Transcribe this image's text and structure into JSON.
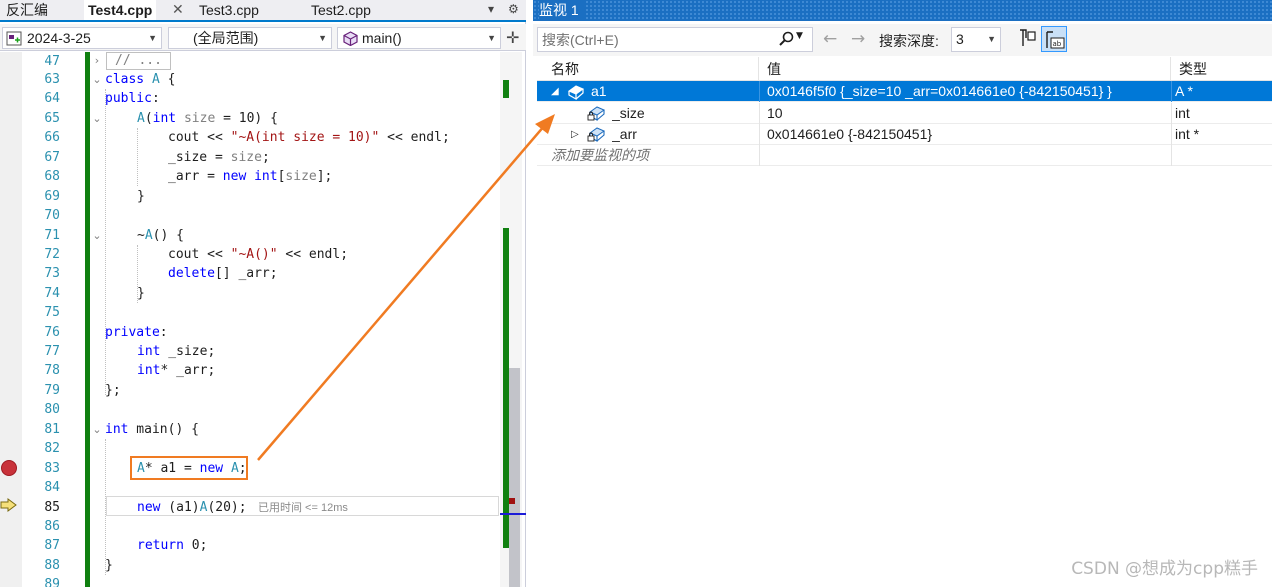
{
  "editor": {
    "tabs": [
      {
        "label": "反汇编",
        "active": false
      },
      {
        "label": "Test4.cpp",
        "active": true
      },
      {
        "label": "Test3.cpp",
        "active": false
      },
      {
        "label": "Test2.cpp",
        "active": false
      }
    ],
    "close_glyph": "✕",
    "navbar": {
      "project": "2024-3-25",
      "scope": "(全局范围)",
      "function": "main()"
    },
    "lines": [
      {
        "n": "47",
        "text": "// ..."
      },
      {
        "n": "63",
        "text": "class A {"
      },
      {
        "n": "64",
        "text": "public:"
      },
      {
        "n": "65",
        "text": "A(int size = 10) {"
      },
      {
        "n": "66",
        "text": "cout << \"~A(int size = 10)\" << endl;"
      },
      {
        "n": "67",
        "text": "_size = size;"
      },
      {
        "n": "68",
        "text": "_arr = new int[size];"
      },
      {
        "n": "69",
        "text": "}"
      },
      {
        "n": "70",
        "text": ""
      },
      {
        "n": "71",
        "text": "~A() {"
      },
      {
        "n": "72",
        "text": "cout << \"~A()\" << endl;"
      },
      {
        "n": "73",
        "text": "delete[] _arr;"
      },
      {
        "n": "74",
        "text": "}"
      },
      {
        "n": "75",
        "text": ""
      },
      {
        "n": "76",
        "text": "private:"
      },
      {
        "n": "77",
        "text": "int _size;"
      },
      {
        "n": "78",
        "text": "int* _arr;"
      },
      {
        "n": "79",
        "text": "};"
      },
      {
        "n": "80",
        "text": ""
      },
      {
        "n": "81",
        "text": "int main() {"
      },
      {
        "n": "82",
        "text": ""
      },
      {
        "n": "83",
        "text": "A* a1 = new A;"
      },
      {
        "n": "84",
        "text": ""
      },
      {
        "n": "85",
        "text": "new (a1)A(20);"
      },
      {
        "n": "86",
        "text": ""
      },
      {
        "n": "87",
        "text": "return 0;"
      },
      {
        "n": "88",
        "text": "}"
      },
      {
        "n": "89",
        "text": ""
      }
    ],
    "perf_tip": "已用时间 <= 12ms",
    "breakpoint_line": "83",
    "current_line": "85"
  },
  "watch": {
    "title": "监视 1",
    "search_placeholder": "搜索(Ctrl+E)",
    "depth_label": "搜索深度:",
    "depth_value": "3",
    "columns": {
      "name": "名称",
      "value": "值",
      "type": "类型"
    },
    "rows": [
      {
        "name": "a1",
        "value": "0x0146f5f0 {_size=10 _arr=0x014661e0 {-842150451} }",
        "type": "A *",
        "expander": "◢",
        "selected": true
      },
      {
        "name": "_size",
        "value": "10",
        "type": "int",
        "expander": "",
        "selected": false
      },
      {
        "name": "_arr",
        "value": "0x014661e0 {-842150451}",
        "type": "int *",
        "expander": "▷",
        "selected": false
      }
    ],
    "add_item_text": "添加要监视的项"
  },
  "watermark": "CSDN @想成为cpp糕手",
  "colors": {
    "accent": "#007acc",
    "selection": "#0078d7",
    "keyword": "#0000ff",
    "type": "#2b91af",
    "string": "#a31515",
    "change_bar": "#108010",
    "breakpoint": "#c8323a",
    "annotation": "#f07b22"
  }
}
